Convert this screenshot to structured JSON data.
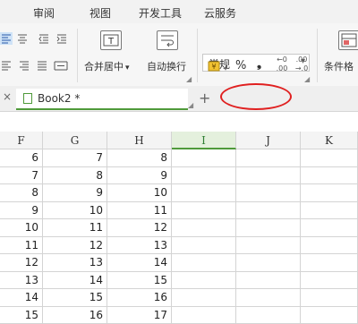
{
  "menu": {
    "tabs": [
      "审阅",
      "视图",
      "开发工具",
      "云服务"
    ]
  },
  "toolbar": {
    "merge_label": "合并居中",
    "merge_arrow": "▾",
    "wrap_label": "自动换行",
    "number_format": "常规",
    "percent": "%",
    "thousands": "❟",
    "inc_decimal_top": "←0",
    "inc_decimal_bottom": ".00",
    "dec_decimal_top": ".00",
    "dec_decimal_bottom": "→.0",
    "conditional_label": "条件格"
  },
  "tabs": {
    "book_name": "Book2 *",
    "add": "+",
    "close": "×"
  },
  "grid": {
    "columns": [
      "F",
      "G",
      "H",
      "I",
      "J",
      "K"
    ],
    "active_column": "I",
    "rows": [
      [
        "6",
        "7",
        "8"
      ],
      [
        "7",
        "8",
        "9"
      ],
      [
        "8",
        "9",
        "10"
      ],
      [
        "9",
        "10",
        "11"
      ],
      [
        "10",
        "11",
        "12"
      ],
      [
        "11",
        "12",
        "13"
      ],
      [
        "12",
        "13",
        "14"
      ],
      [
        "13",
        "14",
        "15"
      ],
      [
        "14",
        "15",
        "16"
      ],
      [
        "15",
        "16",
        "17"
      ]
    ]
  }
}
